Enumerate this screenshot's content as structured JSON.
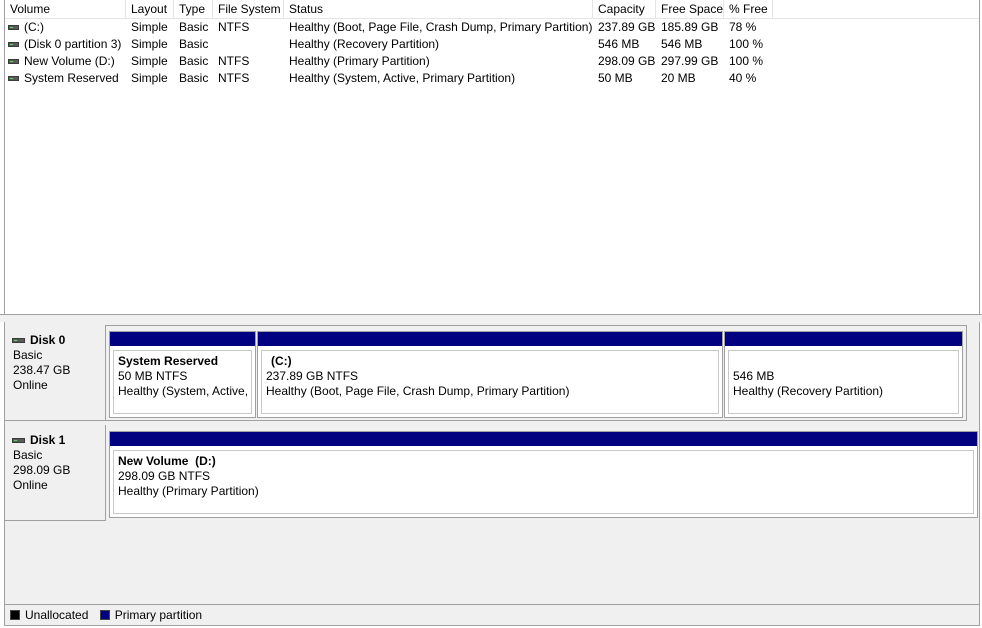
{
  "list": {
    "columns": [
      "Volume",
      "Layout",
      "Type",
      "File System",
      "Status",
      "Capacity",
      "Free Space",
      "% Free"
    ],
    "rows": [
      {
        "volume": "(C:)",
        "layout": "Simple",
        "type": "Basic",
        "fs": "NTFS",
        "status": "Healthy (Boot, Page File, Crash Dump, Primary Partition)",
        "capacity": "237.89 GB",
        "free": "185.89 GB",
        "pct": "78 %"
      },
      {
        "volume": "(Disk 0 partition 3)",
        "layout": "Simple",
        "type": "Basic",
        "fs": "",
        "status": "Healthy (Recovery Partition)",
        "capacity": "546 MB",
        "free": "546 MB",
        "pct": "100 %"
      },
      {
        "volume": "New Volume (D:)",
        "layout": "Simple",
        "type": "Basic",
        "fs": "NTFS",
        "status": "Healthy (Primary Partition)",
        "capacity": "298.09 GB",
        "free": "297.99 GB",
        "pct": "100 %"
      },
      {
        "volume": "System Reserved",
        "layout": "Simple",
        "type": "Basic",
        "fs": "NTFS",
        "status": "Healthy (System, Active, Primary Partition)",
        "capacity": "50 MB",
        "free": "20 MB",
        "pct": "40 %"
      }
    ]
  },
  "disks": [
    {
      "name": "Disk 0",
      "type": "Basic",
      "size": "238.47 GB",
      "state": "Online",
      "partitions": [
        {
          "name": "System Reserved",
          "size": "50 MB NTFS",
          "status": "Healthy (System, Active,"
        },
        {
          "name": "(C:)",
          "size": "237.89 GB NTFS",
          "status": "Healthy (Boot, Page File, Crash Dump, Primary Partition)"
        },
        {
          "name": "",
          "size": "546 MB",
          "status": "Healthy (Recovery Partition)"
        }
      ]
    },
    {
      "name": "Disk 1",
      "type": "Basic",
      "size": "298.09 GB",
      "state": "Online",
      "partitions": [
        {
          "name": "New Volume  (D:)",
          "size": "298.09 GB NTFS",
          "status": "Healthy (Primary Partition)"
        }
      ]
    }
  ],
  "legend": {
    "unallocated": "Unallocated",
    "primary": "Primary partition",
    "colors": {
      "unallocated": "#000000",
      "primary": "#000080"
    }
  },
  "icons": {
    "drive": "drive-icon",
    "disk": "disk-icon"
  }
}
